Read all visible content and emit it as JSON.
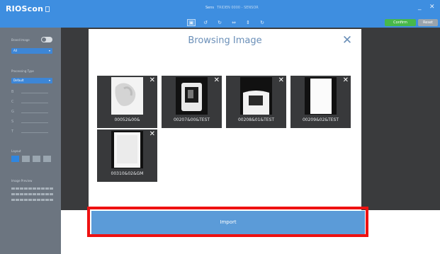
{
  "app": {
    "logo": "RIOScon",
    "window_title": "Sens",
    "window_subtitle": "TRIDEN 0000 - SENSOR",
    "window_controls": {
      "minimize": "_",
      "close": "✕"
    }
  },
  "toolbar": {
    "tools": [
      {
        "icon": "select-icon",
        "glyph": "▣"
      },
      {
        "icon": "rotate-left-icon",
        "glyph": "↺"
      },
      {
        "icon": "rotate-right-icon",
        "glyph": "↻"
      },
      {
        "icon": "flip-horizontal-icon",
        "glyph": "⇔"
      },
      {
        "icon": "flip-vertical-icon",
        "glyph": "⇕"
      },
      {
        "icon": "reset-icon",
        "glyph": "↻"
      }
    ],
    "confirm_label": "Confirm",
    "reset_label": "Reset"
  },
  "sidebar": {
    "auto_label": "Brand Image",
    "select_value": "All",
    "processing_label": "Processing Type",
    "processing_value": "Default",
    "sliders": [
      "B",
      "C",
      "G",
      "S",
      "T"
    ],
    "layout_label": "Layout",
    "image_preview_label": "Image Preview"
  },
  "dialog": {
    "title": "Browsing Image",
    "close_glyph": "✕",
    "images": [
      {
        "name": "00052&00&",
        "remove_glyph": "✕"
      },
      {
        "name": "00207&00&TEST",
        "remove_glyph": "✕"
      },
      {
        "name": "00208&01&TEST",
        "remove_glyph": "✕"
      },
      {
        "name": "00209&02&TEST",
        "remove_glyph": "✕"
      },
      {
        "name": "00310&02&GM",
        "remove_glyph": "✕"
      }
    ]
  },
  "import_button": {
    "label": "Import"
  },
  "colors": {
    "title_bar": "#3e8ee0",
    "sidebar": "#6c7580",
    "workspace": "#3a3b3d",
    "dialog_accent": "#6a8fb8",
    "import_button": "#5b9bd8",
    "highlight": "#ee1111"
  }
}
